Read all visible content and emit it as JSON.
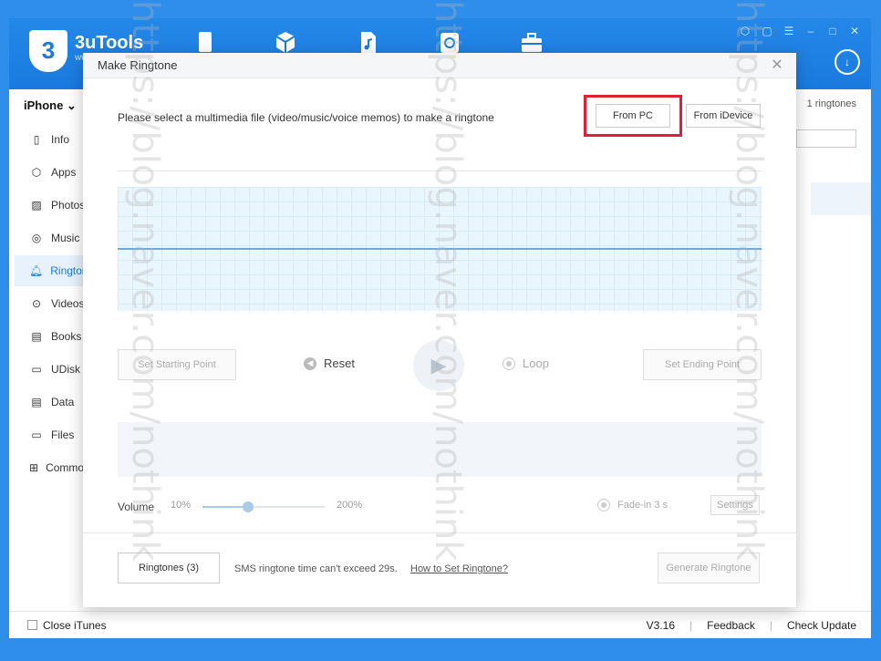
{
  "app": {
    "logo_number": "3",
    "logo_name": "3uTools",
    "logo_sub": "ww",
    "nav_icons": [
      "phone-icon",
      "apps-cube-icon",
      "music-file-icon",
      "sync-icon",
      "toolbox-icon"
    ],
    "window_controls": [
      "skin-icon",
      "square-icon",
      "menu-icon",
      "minimize-icon",
      "maximize-icon",
      "close-icon"
    ]
  },
  "sidebar": {
    "device": "iPhone",
    "items": [
      {
        "label": "Info",
        "icon": "info-icon"
      },
      {
        "label": "Apps",
        "icon": "apps-icon"
      },
      {
        "label": "Photos",
        "icon": "photos-icon"
      },
      {
        "label": "Music",
        "icon": "music-icon"
      },
      {
        "label": "Ringtones",
        "icon": "bell-icon",
        "active": true
      },
      {
        "label": "Videos",
        "icon": "video-icon"
      },
      {
        "label": "Books",
        "icon": "books-icon"
      },
      {
        "label": "UDisk",
        "icon": "udisk-icon"
      },
      {
        "label": "Data",
        "icon": "data-icon"
      },
      {
        "label": "Files",
        "icon": "folder-icon"
      },
      {
        "label": "Common",
        "icon": "grid-icon"
      }
    ]
  },
  "right_panel": {
    "ringtone_count": "1 ringtones"
  },
  "status": {
    "close_itunes": "Close iTunes",
    "version": "V3.16",
    "feedback": "Feedback",
    "check_update": "Check Update"
  },
  "dialog": {
    "title": "Make Ringtone",
    "prompt": "Please select a multimedia file (video/music/voice memos) to make a ringtone",
    "from_pc": "From PC",
    "from_idevice": "From iDevice",
    "set_start": "Set Starting Point",
    "reset": "Reset",
    "loop": "Loop",
    "set_end": "Set Ending Point",
    "volume_label": "Volume",
    "volume_min": "10%",
    "volume_max": "200%",
    "volume_level": 0.37,
    "fade_in": "Fade-in 3 s",
    "settings": "Settings",
    "ringtones_btn": "Ringtones (3)",
    "sms_note": "SMS ringtone time can't exceed 29s.",
    "how_to": "How to Set Ringtone?",
    "generate": "Generate Ringtone"
  },
  "watermark": "https://blog.naver.com/nothink"
}
